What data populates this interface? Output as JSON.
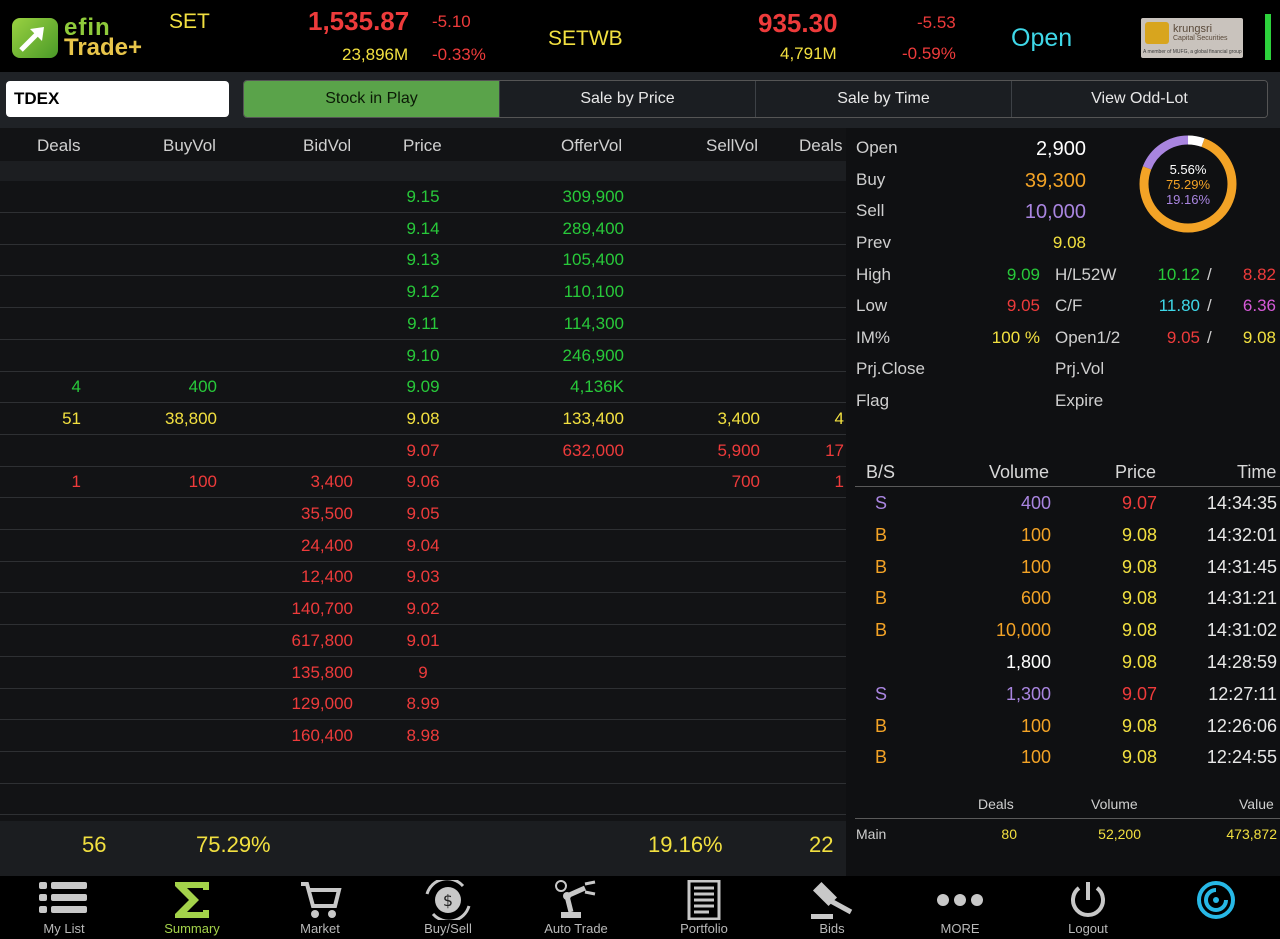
{
  "header": {
    "logo_efin": "efin",
    "logo_trade": "Trade+",
    "set_label": "SET",
    "set_index": "1,535.87",
    "set_change": "-5.10",
    "set_value": "23,896M",
    "set_pct": "-0.33%",
    "setwb_label": "SETWB",
    "setwb_index": "935.30",
    "setwb_change": "-5.53",
    "setwb_value": "4,791M",
    "setwb_pct": "-0.59%",
    "market_status": "Open",
    "broker_name": "krungsri",
    "broker_sub": "Capital Securities",
    "broker_foot": "A member of MUFG, a global financial group"
  },
  "search": {
    "value": "TDEX"
  },
  "tabs": [
    {
      "label": "Stock in Play",
      "active": true
    },
    {
      "label": "Sale by Price",
      "active": false
    },
    {
      "label": "Sale by Time",
      "active": false
    },
    {
      "label": "View Odd-Lot",
      "active": false
    }
  ],
  "book": {
    "headers": {
      "deals": "Deals",
      "buyvol": "BuyVol",
      "bidvol": "BidVol",
      "price": "Price",
      "offervol": "OfferVol",
      "sellvol": "SellVol",
      "deals2": "Deals"
    },
    "rows": [
      {
        "bdeals": "",
        "buyvol": "",
        "bidvol": "",
        "price": "9.15",
        "offervol": "309,900",
        "sellvol": "",
        "sdeals": "",
        "color": "green"
      },
      {
        "bdeals": "",
        "buyvol": "",
        "bidvol": "",
        "price": "9.14",
        "offervol": "289,400",
        "sellvol": "",
        "sdeals": "",
        "color": "green"
      },
      {
        "bdeals": "",
        "buyvol": "",
        "bidvol": "",
        "price": "9.13",
        "offervol": "105,400",
        "sellvol": "",
        "sdeals": "",
        "color": "green"
      },
      {
        "bdeals": "",
        "buyvol": "",
        "bidvol": "",
        "price": "9.12",
        "offervol": "110,100",
        "sellvol": "",
        "sdeals": "",
        "color": "green"
      },
      {
        "bdeals": "",
        "buyvol": "",
        "bidvol": "",
        "price": "9.11",
        "offervol": "114,300",
        "sellvol": "",
        "sdeals": "",
        "color": "green"
      },
      {
        "bdeals": "",
        "buyvol": "",
        "bidvol": "",
        "price": "9.10",
        "offervol": "246,900",
        "sellvol": "",
        "sdeals": "",
        "color": "green"
      },
      {
        "bdeals": "4",
        "buyvol": "400",
        "bidvol": "",
        "price": "9.09",
        "offervol": "4,136K",
        "sellvol": "",
        "sdeals": "",
        "color": "green"
      },
      {
        "bdeals": "51",
        "buyvol": "38,800",
        "bidvol": "",
        "price": "9.08",
        "offervol": "133,400",
        "sellvol": "3,400",
        "sdeals": "4",
        "color": "yellow"
      },
      {
        "bdeals": "",
        "buyvol": "",
        "bidvol": "",
        "price": "9.07",
        "offervol": "632,000",
        "sellvol": "5,900",
        "sdeals": "17",
        "color": "red"
      },
      {
        "bdeals": "1",
        "buyvol": "100",
        "bidvol": "3,400",
        "price": "9.06",
        "offervol": "",
        "sellvol": "700",
        "sdeals": "1",
        "color": "red"
      },
      {
        "bdeals": "",
        "buyvol": "",
        "bidvol": "35,500",
        "price": "9.05",
        "offervol": "",
        "sellvol": "",
        "sdeals": "",
        "color": "red"
      },
      {
        "bdeals": "",
        "buyvol": "",
        "bidvol": "24,400",
        "price": "9.04",
        "offervol": "",
        "sellvol": "",
        "sdeals": "",
        "color": "red"
      },
      {
        "bdeals": "",
        "buyvol": "",
        "bidvol": "12,400",
        "price": "9.03",
        "offervol": "",
        "sellvol": "",
        "sdeals": "",
        "color": "red"
      },
      {
        "bdeals": "",
        "buyvol": "",
        "bidvol": "140,700",
        "price": "9.02",
        "offervol": "",
        "sellvol": "",
        "sdeals": "",
        "color": "red"
      },
      {
        "bdeals": "",
        "buyvol": "",
        "bidvol": "617,800",
        "price": "9.01",
        "offervol": "",
        "sellvol": "",
        "sdeals": "",
        "color": "red"
      },
      {
        "bdeals": "",
        "buyvol": "",
        "bidvol": "135,800",
        "price": "9",
        "offervol": "",
        "sellvol": "",
        "sdeals": "",
        "color": "red"
      },
      {
        "bdeals": "",
        "buyvol": "",
        "bidvol": "129,000",
        "price": "8.99",
        "offervol": "",
        "sellvol": "",
        "sdeals": "",
        "color": "red"
      },
      {
        "bdeals": "",
        "buyvol": "",
        "bidvol": "160,400",
        "price": "8.98",
        "offervol": "",
        "sellvol": "",
        "sdeals": "",
        "color": "red"
      }
    ],
    "footer": {
      "buy_deals": "56",
      "buy_pct": "75.29%",
      "sell_pct": "19.16%",
      "sell_deals": "22"
    }
  },
  "stats": {
    "open_label": "Open",
    "open_value": "2,900",
    "buy_label": "Buy",
    "buy_value": "39,300",
    "sell_label": "Sell",
    "sell_value": "10,000",
    "prev_label": "Prev",
    "prev_value": "9.08",
    "high_label": "High",
    "high_value": "9.09",
    "low_label": "Low",
    "low_value": "9.05",
    "im_label": "IM%",
    "im_value": "100 %",
    "prjclose_label": "Prj.Close",
    "flag_label": "Flag",
    "hl52_label": "H/L52W",
    "hl52_high": "10.12",
    "hl52_low": "8.82",
    "cf_label": "C/F",
    "cf_ceil": "11.80",
    "cf_floor": "6.36",
    "open12_label": "Open1/2",
    "open1": "9.05",
    "open2": "9.08",
    "prjvol_label": "Prj.Vol",
    "expire_label": "Expire",
    "slash": "/",
    "donut": {
      "white_pct": "5.56%",
      "orange_pct": "75.29%",
      "purple_pct": "19.16%",
      "white_frac": 0.0556,
      "orange_frac": 0.7529,
      "purple_frac": 0.1916
    }
  },
  "trades": {
    "headers": {
      "bs": "B/S",
      "volume": "Volume",
      "price": "Price",
      "time": "Time"
    },
    "rows": [
      {
        "side": "S",
        "volume": "400",
        "price": "9.07",
        "time": "14:34:35"
      },
      {
        "side": "B",
        "volume": "100",
        "price": "9.08",
        "time": "14:32:01"
      },
      {
        "side": "B",
        "volume": "100",
        "price": "9.08",
        "time": "14:31:45"
      },
      {
        "side": "B",
        "volume": "600",
        "price": "9.08",
        "time": "14:31:21"
      },
      {
        "side": "B",
        "volume": "10,000",
        "price": "9.08",
        "time": "14:31:02"
      },
      {
        "side": "",
        "volume": "1,800",
        "price": "9.08",
        "time": "14:28:59"
      },
      {
        "side": "S",
        "volume": "1,300",
        "price": "9.07",
        "time": "12:27:11"
      },
      {
        "side": "B",
        "volume": "100",
        "price": "9.08",
        "time": "12:26:06"
      },
      {
        "side": "B",
        "volume": "100",
        "price": "9.08",
        "time": "12:24:55"
      }
    ]
  },
  "summary": {
    "deals_label": "Deals",
    "volume_label": "Volume",
    "value_label": "Value",
    "row_label": "Main",
    "deals": "80",
    "volume": "52,200",
    "value": "473,872"
  },
  "nav": [
    {
      "label": "My List",
      "icon": "list-icon"
    },
    {
      "label": "Summary",
      "icon": "sigma-icon",
      "active": true
    },
    {
      "label": "Market",
      "icon": "cart-icon"
    },
    {
      "label": "Buy/Sell",
      "icon": "exchange-icon"
    },
    {
      "label": "Auto Trade",
      "icon": "robot-arm-icon"
    },
    {
      "label": "Portfolio",
      "icon": "document-icon"
    },
    {
      "label": "Bids",
      "icon": "gavel-icon"
    },
    {
      "label": "MORE",
      "icon": "more-icon"
    },
    {
      "label": "Logout",
      "icon": "power-icon"
    },
    {
      "label": "",
      "icon": "refresh-icon"
    }
  ]
}
